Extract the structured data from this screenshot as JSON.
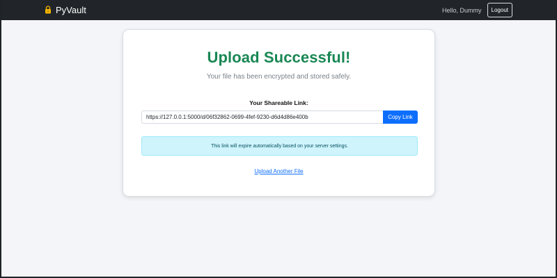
{
  "navbar": {
    "brand": "PyVault",
    "brand_icon": "lock-icon",
    "greeting": "Hello, Dummy",
    "logout_label": "Logout"
  },
  "card": {
    "title": "Upload Successful!",
    "subtitle": "Your file has been encrypted and stored safely.",
    "link_label": "Your Shareable Link:",
    "link_value": "https://127.0.0.1:5000/d/06f32862-0699-4fef-9230-d6d4d86e400b",
    "copy_label": "Copy Link",
    "alert_text": "This link will expire automatically based on your server settings.",
    "upload_another_label": "Upload Another File"
  },
  "colors": {
    "navbar_bg": "#212529",
    "success": "#198754",
    "primary": "#0d6efd",
    "alert_bg": "#cff4fc",
    "page_bg": "#f3f5f8"
  }
}
